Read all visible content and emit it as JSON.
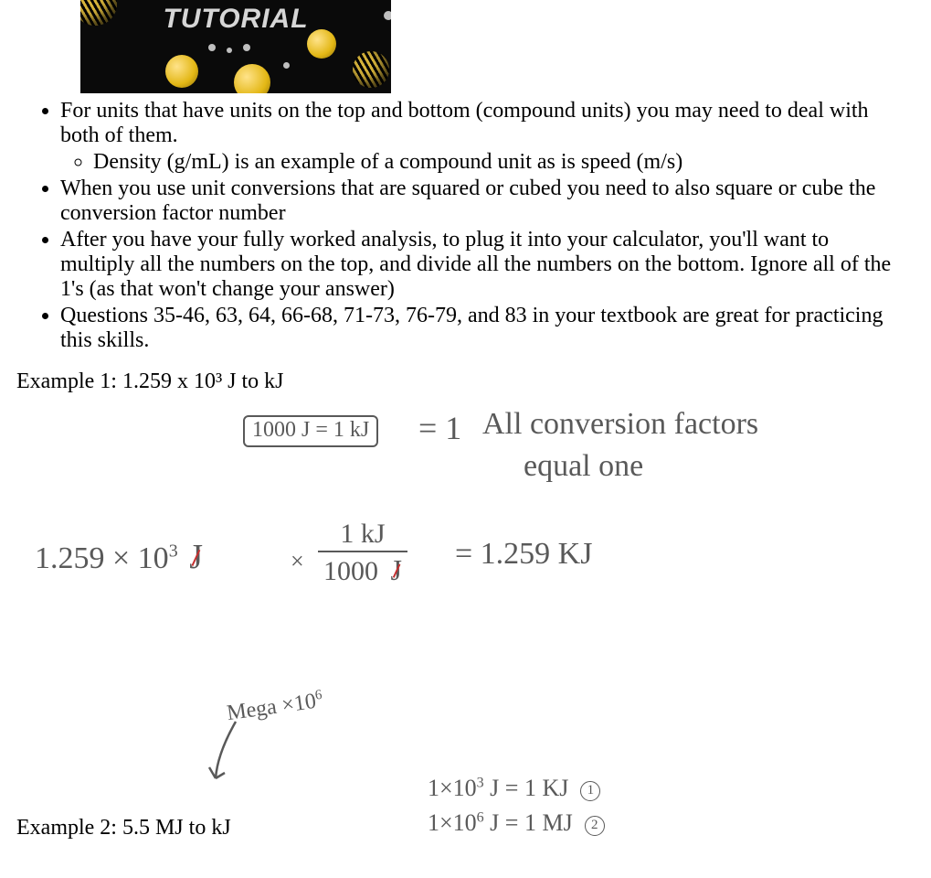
{
  "banner": {
    "title": "TUTORIAL"
  },
  "bullets": {
    "b1": "For units that have units on the top and bottom (compound units) you may need to deal with both of them.",
    "b1a": "Density (g/mL) is an example of a compound unit as is speed (m/s)",
    "b2": "When you use unit conversions that are squared or cubed you need to also square or cube the conversion factor number",
    "b3": "After you have your fully worked analysis, to plug it into your calculator, you'll want to multiply all the numbers on the top, and divide all the numbers on the bottom. Ignore all of the 1's (as that won't change your answer)",
    "b4": "Questions 35-46, 63, 64, 66-68, 71-73, 76-79, and 83 in your textbook are great for practicing this skills."
  },
  "example1": {
    "label": "Example 1: 1.259 x 10³ J to kJ",
    "box": "1000 J = 1 kJ",
    "eq1a": "= 1",
    "note1": "All conversion factors",
    "note2": "equal one",
    "lhs_val": "1.259 × 10",
    "lhs_exp": "3",
    "lhs_unit": "J",
    "times": "×",
    "frac_num_val": "1 kJ",
    "frac_den_val": "1000",
    "frac_den_unit": "J",
    "rhs": "= 1.259 KJ"
  },
  "example2": {
    "label": "Example 2: 5.5 MJ to kJ",
    "annot": "Mega ×10",
    "annot_exp": "6",
    "line1a": "1×10",
    "line1exp": "3",
    "line1b": "J = 1 KJ",
    "circ1": "1",
    "line2a": "1×10",
    "line2exp": "6",
    "line2b": "J = 1 MJ",
    "circ2": "2"
  }
}
